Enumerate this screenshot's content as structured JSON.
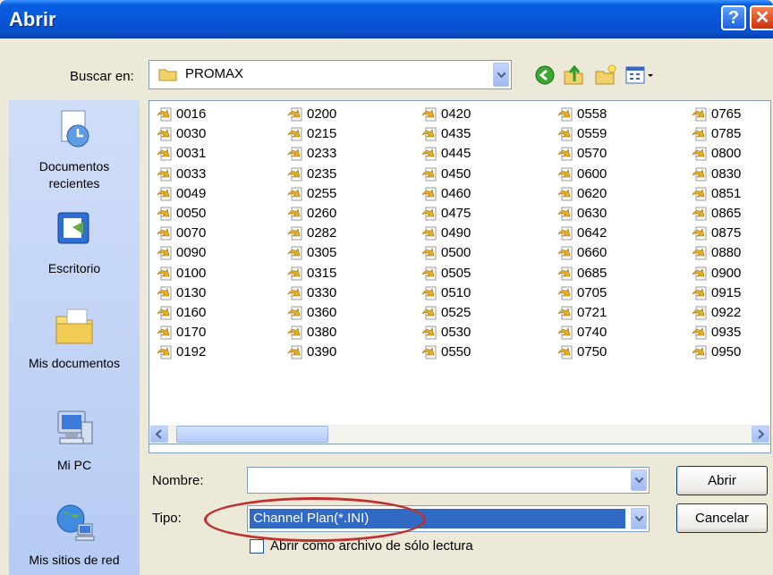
{
  "window": {
    "title": "Abrir",
    "help_glyph": "?",
    "close_glyph": "✕"
  },
  "lookin": {
    "label": "Buscar en:",
    "value": "PROMAX"
  },
  "toolbar": {
    "icons": [
      "back-icon",
      "up-folder-icon",
      "new-folder-icon",
      "view-menu-icon"
    ]
  },
  "places": [
    {
      "label_lines": [
        "Documentos",
        "recientes"
      ],
      "icon": "recent-documents-icon"
    },
    {
      "label_lines": [
        "Escritorio"
      ],
      "icon": "desktop-icon"
    },
    {
      "label_lines": [
        "Mis documentos"
      ],
      "icon": "my-documents-icon"
    },
    {
      "label_lines": [
        "Mi PC"
      ],
      "icon": "my-computer-icon"
    },
    {
      "label_lines": [
        "Mis sitios de red"
      ],
      "icon": "network-places-icon"
    }
  ],
  "files": {
    "columns": [
      [
        "0016",
        "0030",
        "0031",
        "0033",
        "0049",
        "0050",
        "0070",
        "0090",
        "0100",
        "0130",
        "0160",
        "0170",
        "0192"
      ],
      [
        "0200",
        "0215",
        "0233",
        "0235",
        "0255",
        "0260",
        "0282",
        "0305",
        "0315",
        "0330",
        "0360",
        "0380",
        "0390"
      ],
      [
        "0420",
        "0435",
        "0445",
        "0450",
        "0460",
        "0475",
        "0490",
        "0500",
        "0505",
        "0510",
        "0525",
        "0530",
        "0550"
      ],
      [
        "0558",
        "0559",
        "0570",
        "0600",
        "0620",
        "0630",
        "0642",
        "0660",
        "0685",
        "0705",
        "0721",
        "0740",
        "0750"
      ],
      [
        "0765",
        "0785",
        "0800",
        "0830",
        "0851",
        "0865",
        "0875",
        "0880",
        "0900",
        "0915",
        "0922",
        "0935",
        "0950"
      ]
    ]
  },
  "filename": {
    "label": "Nombre:",
    "value": ""
  },
  "filetype": {
    "label": "Tipo:",
    "value": "Channel Plan(*.INI)"
  },
  "buttons": {
    "open": "Abrir",
    "cancel": "Cancelar"
  },
  "readonly": {
    "label": "Abrir como archivo de sólo lectura",
    "checked": false
  },
  "colors": {
    "titlebar": "#0A5FE0",
    "selection": "#316AC5",
    "highlight_ellipse": "#C0302E"
  }
}
